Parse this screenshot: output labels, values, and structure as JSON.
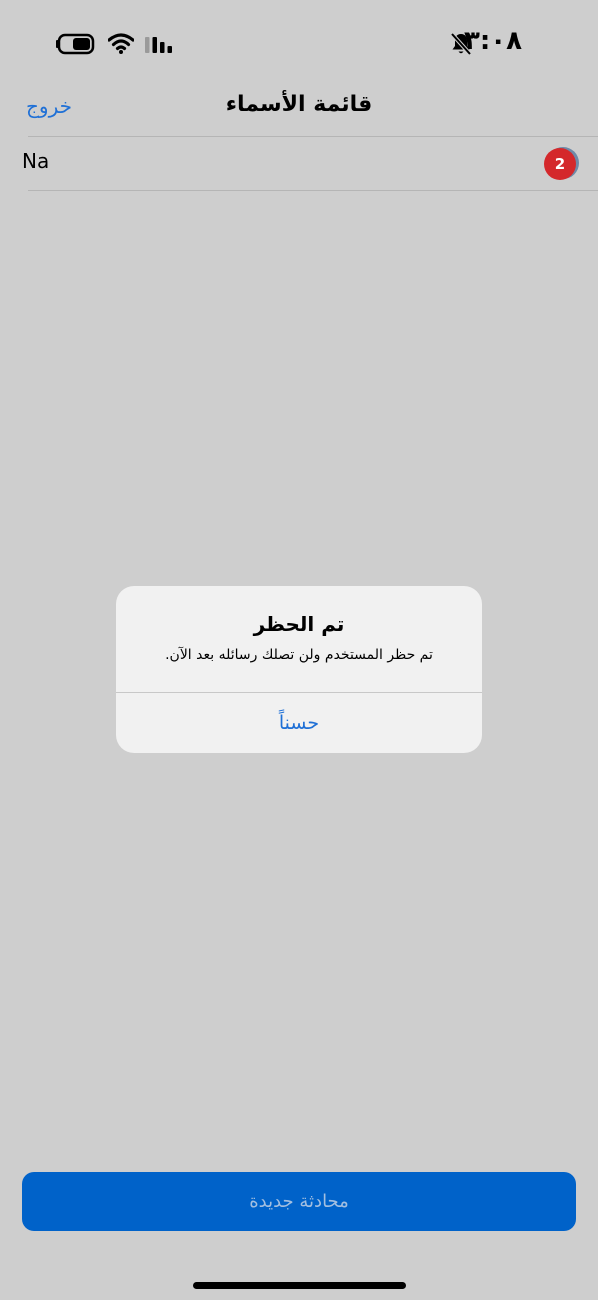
{
  "status_bar": {
    "time": "٣:٠٨",
    "icons": [
      "bell-slash-icon",
      "battery-icon",
      "wifi-icon",
      "signal-icon"
    ]
  },
  "nav": {
    "title": "قائمة الأسماء",
    "exit_label": "خروج"
  },
  "contacts": [
    {
      "name": "Na",
      "unread_count": "2"
    }
  ],
  "alert": {
    "title": "تم الحظر",
    "message": "تم حظر المستخدم ولن تصلك رسائله بعد الآن.",
    "ok_label": "حسناً"
  },
  "footer": {
    "new_chat_label": "محادثة جديدة"
  },
  "colors": {
    "accent": "#1f70d6",
    "primary_button": "#0062c9",
    "badge": "#d4282b",
    "dimmed_background": "#cecece"
  }
}
